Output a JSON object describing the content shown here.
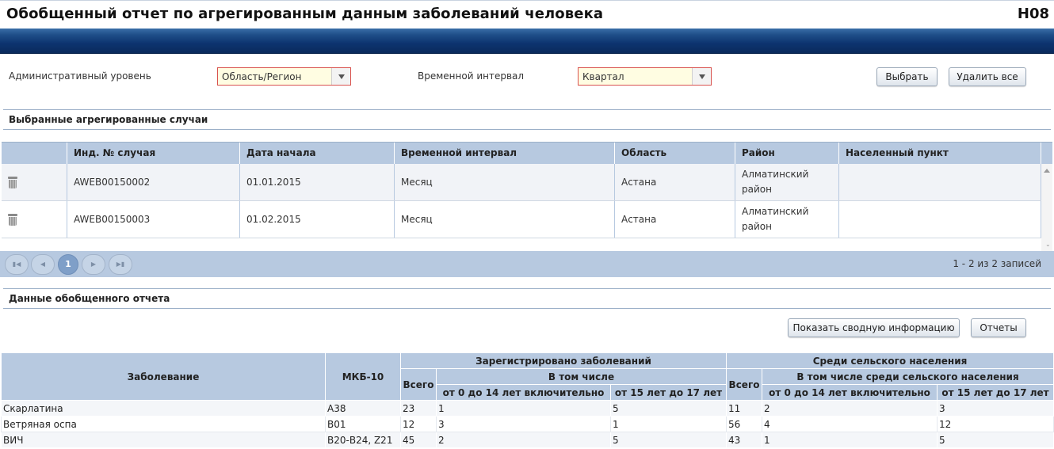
{
  "header": {
    "title": "Обобщенный отчет по агрегированным данным заболеваний человека",
    "code": "H08"
  },
  "filters": {
    "admin_level": {
      "label": "Административный уровень",
      "value": "Область/Регион"
    },
    "time_interval": {
      "label": "Временной интервал",
      "value": "Квартал"
    },
    "select_button": "Выбрать",
    "delete_all_button": "Удалить все"
  },
  "selected_cases": {
    "section_title": "Выбранные агрегированные случаи",
    "columns": [
      "Инд. № случая",
      "Дата начала",
      "Временной интервал",
      "Область",
      "Район",
      "Населенный пункт"
    ],
    "rows": [
      {
        "id": "AWEB00150002",
        "start": "01.01.2015",
        "interval": "Месяц",
        "region": "Астана",
        "district": "Алматинский район",
        "settlement": ""
      },
      {
        "id": "AWEB00150003",
        "start": "01.02.2015",
        "interval": "Месяц",
        "region": "Астана",
        "district": "Алматинский район",
        "settlement": ""
      }
    ],
    "pager": {
      "current_page": "1",
      "info": "1 - 2 из 2 записей"
    }
  },
  "report": {
    "section_title": "Данные обобщенного отчета",
    "summary_button": "Показать сводную информацию",
    "reports_button": "Отчеты",
    "headers": {
      "disease": "Заболевание",
      "icd": "МКБ-10",
      "registered": "Зарегистрировано заболеваний",
      "including": "В том числе",
      "total": "Всего",
      "age_0_14": "от 0 до 14 лет включительно",
      "age_15_17": "от 15 лет до 17 лет",
      "rural": "Среди сельского населения",
      "rural_including": "В том числе среди сельского населения",
      "rural_total": "Всего",
      "rural_0_14": "от 0 до 14 лет включительно",
      "rural_15_17": "от 15 лет до 17 лет"
    },
    "rows": [
      {
        "disease": "Скарлатина",
        "icd": "А38",
        "total": "23",
        "a0_14": "1",
        "a15_17": "5",
        "r_total": "11",
        "r0_14": "2",
        "r15_17": "3"
      },
      {
        "disease": "Ветряная оспа",
        "icd": "В01",
        "total": "12",
        "a0_14": "3",
        "a15_17": "1",
        "r_total": "56",
        "r0_14": "4",
        "r15_17": "12"
      },
      {
        "disease": "ВИЧ",
        "icd": "В20-В24, Z21",
        "total": "45",
        "a0_14": "2",
        "a15_17": "5",
        "r_total": "43",
        "r0_14": "1",
        "r15_17": "5"
      }
    ]
  }
}
